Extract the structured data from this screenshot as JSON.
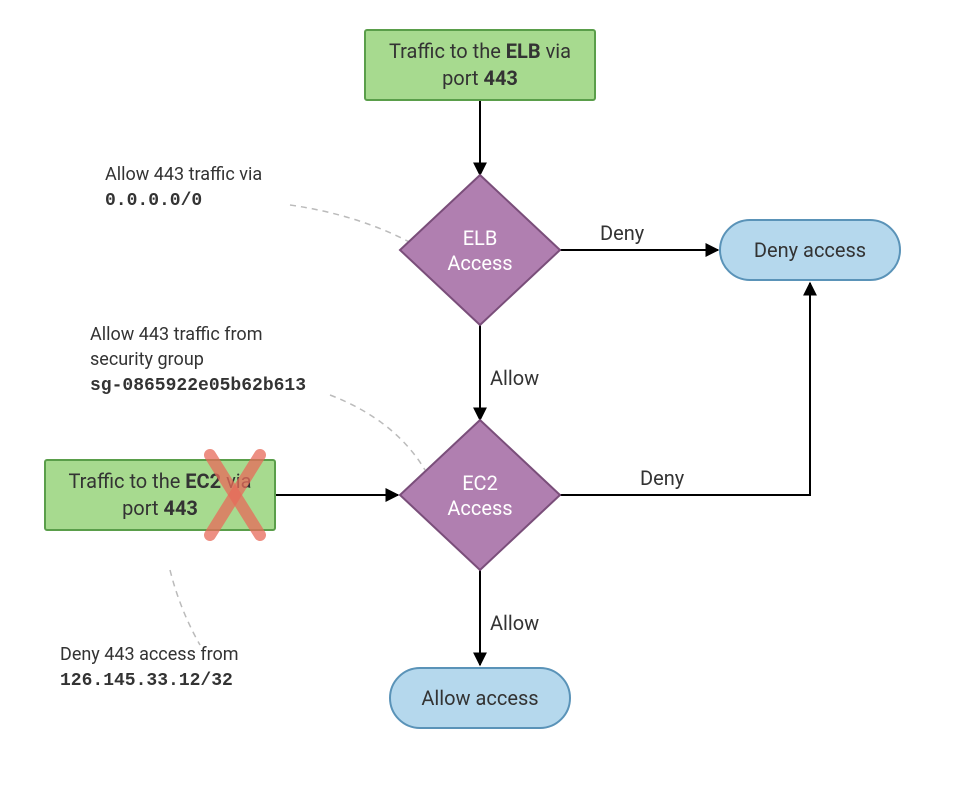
{
  "nodes": {
    "start_top": {
      "line1_pre": "Traffic to the ",
      "line1_b": "ELB",
      "line1_post": " via",
      "line2_pre": "port ",
      "line2_b": "443"
    },
    "elb_dec": {
      "line1": "ELB",
      "line2": "Access"
    },
    "ec2_dec": {
      "line1": "EC2",
      "line2": "Access"
    },
    "deny_pill": {
      "label": "Deny access"
    },
    "allow_pill": {
      "label": "Allow access"
    },
    "start_left": {
      "line1_pre": "Traffic to the ",
      "line1_b": "EC2",
      "line1_post": " via",
      "line2_pre": "port ",
      "line2_b": "443"
    }
  },
  "notes": {
    "elb_note": {
      "line1": "Allow 443 traffic via",
      "line2_mono": "0.0.0.0/0"
    },
    "ec2_note": {
      "line1": "Allow 443 traffic from",
      "line2": "security group",
      "line3_mono": "sg-0865922e05b62b613"
    },
    "deny_note": {
      "line1": "Deny 443 access from",
      "line2_mono": "126.145.33.12/32"
    }
  },
  "edges": {
    "top_to_elb": "",
    "elb_allow": "Allow",
    "elb_deny": "Deny",
    "ec2_allow": "Allow",
    "ec2_deny": "Deny",
    "left_to_ec2": ""
  }
}
